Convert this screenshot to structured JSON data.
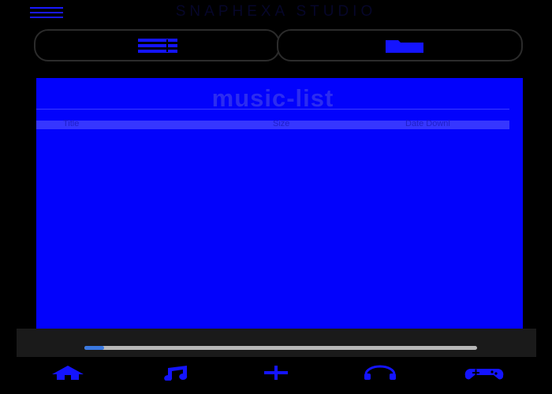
{
  "header": {
    "app_title": "SNAPHEXA STUDIO",
    "menu_icon": "hamburger-menu-icon"
  },
  "view_toggle": [
    {
      "icon": "list-icon"
    },
    {
      "icon": "folder-icon"
    }
  ],
  "library": {
    "title": "music-list",
    "columns": [
      "Title",
      "Size",
      "Date Downl"
    ],
    "rows": []
  },
  "player": {
    "progress": 0.05
  },
  "bottom_nav": [
    {
      "icon": "home-icon"
    },
    {
      "icon": "music-note-icon"
    },
    {
      "icon": "plus-icon"
    },
    {
      "icon": "headphones-icon"
    },
    {
      "icon": "gamepad-icon"
    }
  ],
  "colors": {
    "background": "#000000",
    "panel": "#0202fc",
    "accent": "#1818ff",
    "progress_fill": "#3a78e0"
  }
}
